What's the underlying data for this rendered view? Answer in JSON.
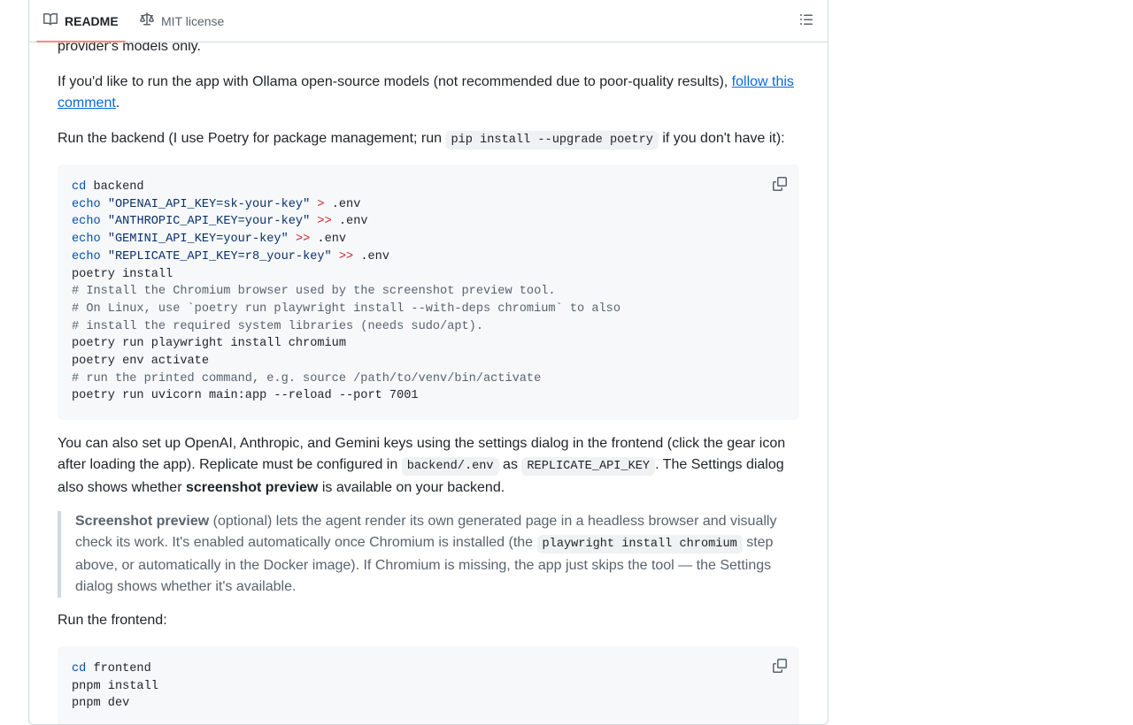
{
  "tabs": {
    "readme": "README",
    "license": "MIT license"
  },
  "icons": {
    "readme": "book-icon",
    "license": "scale-icon",
    "outline": "list-unordered-icon",
    "copy": "copy-icon"
  },
  "intro_tail": "provider's models only.",
  "ollama": {
    "text": "If you'd like to run the app with Ollama open-source models (not recommended due to poor-quality results), ",
    "link": "follow this comment",
    "end": "."
  },
  "backend_intro": {
    "before": "Run the backend (I use Poetry for package management; run ",
    "code": "pip install --upgrade poetry",
    "after": " if you don't have it):"
  },
  "backend_code": [
    [
      [
        "kw",
        "cd"
      ],
      [
        "p",
        " backend"
      ]
    ],
    [
      [
        "kw",
        "echo"
      ],
      [
        "p",
        " "
      ],
      [
        "str",
        "\"OPENAI_API_KEY=sk-your-key\""
      ],
      [
        "p",
        " "
      ],
      [
        "op",
        ">"
      ],
      [
        "p",
        " .env"
      ]
    ],
    [
      [
        "kw",
        "echo"
      ],
      [
        "p",
        " "
      ],
      [
        "str",
        "\"ANTHROPIC_API_KEY=your-key\""
      ],
      [
        "p",
        " "
      ],
      [
        "op",
        ">>"
      ],
      [
        "p",
        " .env"
      ]
    ],
    [
      [
        "kw",
        "echo"
      ],
      [
        "p",
        " "
      ],
      [
        "str",
        "\"GEMINI_API_KEY=your-key\""
      ],
      [
        "p",
        " "
      ],
      [
        "op",
        ">>"
      ],
      [
        "p",
        " .env"
      ]
    ],
    [
      [
        "kw",
        "echo"
      ],
      [
        "p",
        " "
      ],
      [
        "str",
        "\"REPLICATE_API_KEY=r8_your-key\""
      ],
      [
        "p",
        " "
      ],
      [
        "op",
        ">>"
      ],
      [
        "p",
        " .env"
      ]
    ],
    [
      [
        "p",
        "poetry install"
      ]
    ],
    [
      [
        "cm",
        "# Install the Chromium browser used by the screenshot preview tool."
      ]
    ],
    [
      [
        "cm",
        "# On Linux, use `poetry run playwright install --with-deps chromium` to also"
      ]
    ],
    [
      [
        "cm",
        "# install the required system libraries (needs sudo/apt)."
      ]
    ],
    [
      [
        "p",
        "poetry run playwright install chromium"
      ]
    ],
    [
      [
        "p",
        "poetry env activate"
      ]
    ],
    [
      [
        "cm",
        "# run the printed command, e.g. source /path/to/venv/bin/activate"
      ]
    ],
    [
      [
        "p",
        "poetry run uvicorn main:app --reload --port 7001"
      ]
    ]
  ],
  "keys_para": {
    "a": "You can also set up OpenAI, Anthropic, and Gemini keys using the settings dialog in the frontend (click the gear icon after loading the app). Replicate must be configured in ",
    "code1": "backend/.env",
    "b": " as ",
    "code2": "REPLICATE_API_KEY",
    "c": ". The Settings dialog also shows whether ",
    "strong": "screenshot preview",
    "d": " is available on your backend."
  },
  "quote": {
    "strong": "Screenshot preview",
    "a": " (optional) lets the agent render its own generated page in a headless browser and visually check its work. It's enabled automatically once Chromium is installed (the ",
    "code": "playwright install chromium",
    "b": " step above, or automatically in the Docker image). If Chromium is missing, the app just skips the tool — the Settings dialog shows whether it's available."
  },
  "frontend_intro": "Run the frontend:",
  "frontend_code": [
    [
      [
        "kw",
        "cd"
      ],
      [
        "p",
        " frontend"
      ]
    ],
    [
      [
        "p",
        "pnpm install"
      ]
    ],
    [
      [
        "p",
        "pnpm dev"
      ]
    ]
  ]
}
